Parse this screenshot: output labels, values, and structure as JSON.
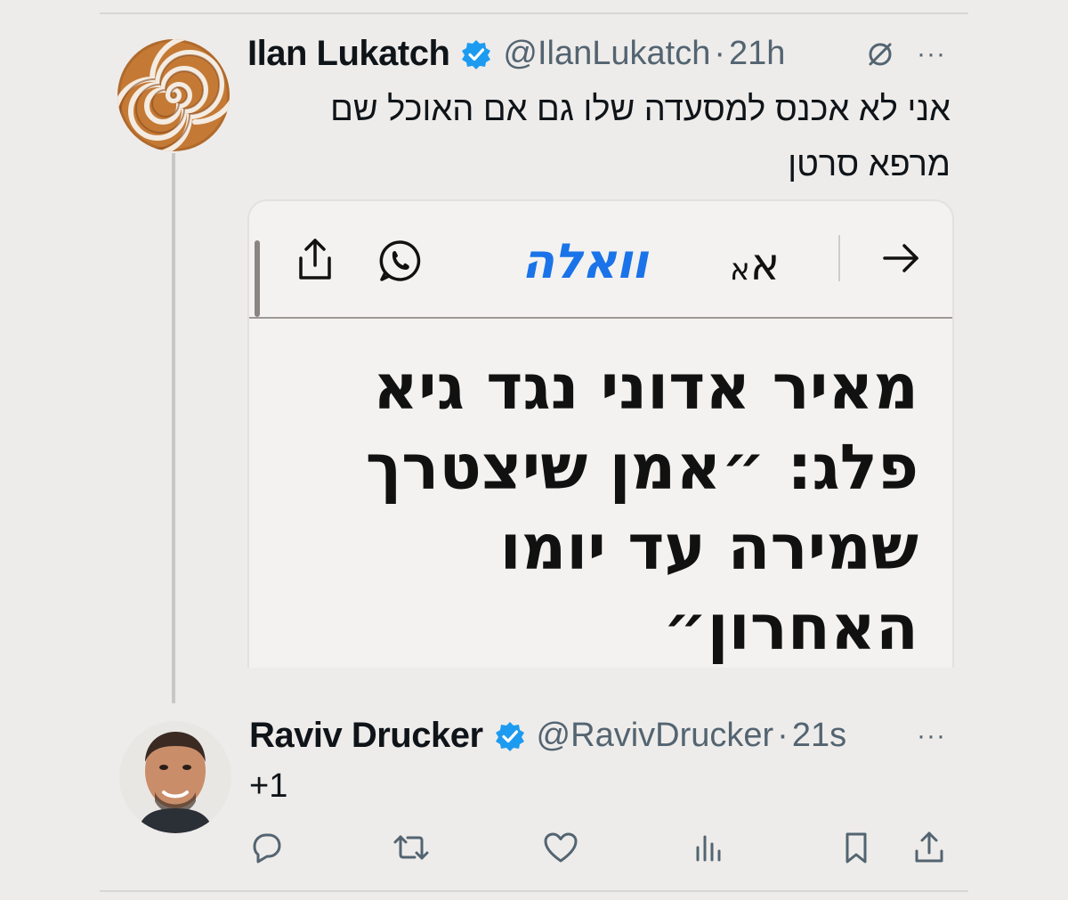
{
  "tweets": [
    {
      "name": "Ilan Lukatch",
      "handle": "@IlanLukatch",
      "time": "21h",
      "text_line1": "אני לא אכנס למסעדה שלו גם אם האוכל שם",
      "text_line2": "מרפא סרטן",
      "icons": [
        "verified-badge-icon",
        "hidden-reply-icon",
        "more-icon"
      ]
    },
    {
      "name": "Raviv Drucker",
      "handle": "@RavivDrucker",
      "time": "21s",
      "text": "+1",
      "icons": [
        "verified-badge-icon",
        "more-icon"
      ]
    }
  ],
  "card": {
    "logo": "וואלה",
    "font_size_big": "א",
    "font_size_small": "א",
    "headline_lines": [
      "מאיר אדוני נגד גיא",
      "פלג: ״אמן שיצטרך",
      "שמירה עד יומו",
      "האחרון״"
    ],
    "toolbar_icons": [
      "share-icon",
      "whatsapp-icon",
      "forward-arrow-icon"
    ]
  },
  "separator": "·",
  "more_label": "···",
  "actions": [
    "reply-icon",
    "retweet-icon",
    "like-icon",
    "views-icon",
    "bookmark-icon",
    "share-icon"
  ],
  "colors": {
    "background": "#eeecea",
    "verified": "#1d9bf0",
    "secondary_text": "#536471",
    "walla_blue": "#1a73e8"
  }
}
